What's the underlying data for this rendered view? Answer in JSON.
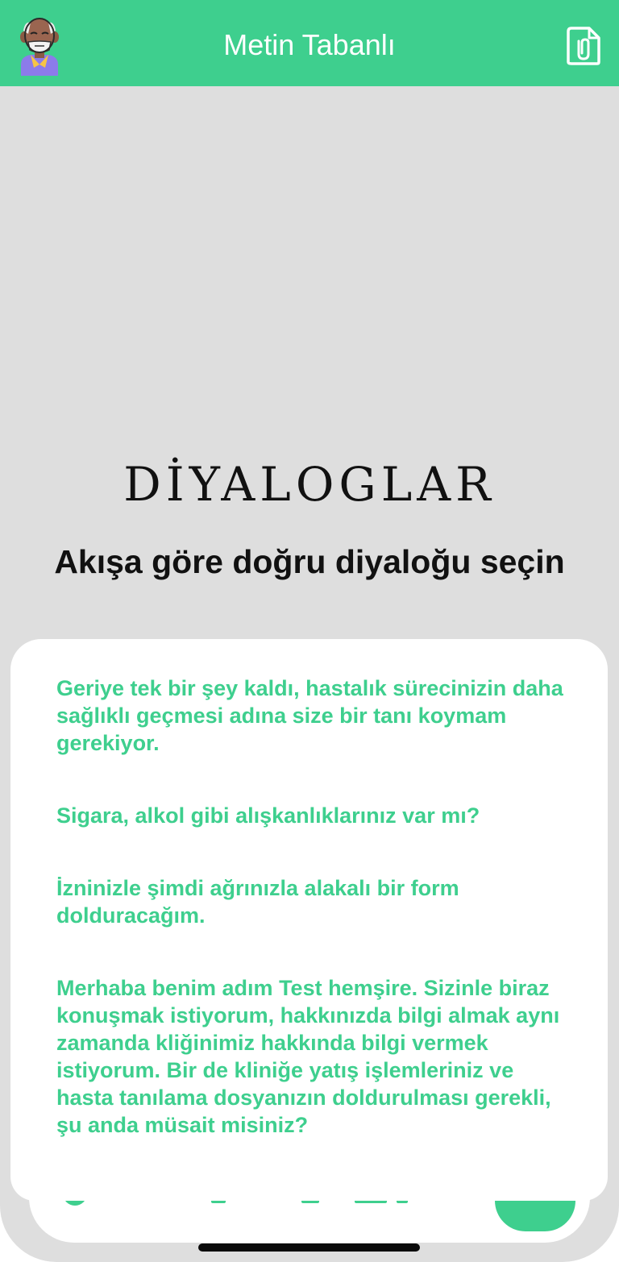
{
  "header": {
    "title": "Metin Tabanlı",
    "background_color": "#3ecf8e",
    "avatar_icon": "elderly-patient-avatar-icon",
    "attach_icon": "paperclip-document-icon"
  },
  "main": {
    "heading": "DİYALOGLAR",
    "subheading": "Akışa göre doğru diyaloğu seçin"
  },
  "dialog_options": [
    {
      "text": "Geriye tek bir şey kaldı, hastalık sürecinizin daha sağlıklı geçmesi adına size bir tanı koymam gerekiyor."
    },
    {
      "text": "Sigara, alkol gibi alışkanlıklarınız var mı?"
    },
    {
      "text": "İzninizle şimdi ağrınızla alakalı bir form dolduracağım."
    },
    {
      "text": "Merhaba benim adım Test hemşire. Sizinle biraz konuşmak istiyorum, hakkınızda bilgi almak aynı zamanda kliğinimiz hakkında bilgi vermek istiyorum. Bir de kliniğe yatış işlemleriniz ve hasta tanılama dosyanızın doldurulması gerekli, şu anda müsait misiniz?"
    }
  ],
  "colors": {
    "accent": "#3ecf8e",
    "background": "#dedede",
    "sheet": "#ffffff",
    "text_dark": "#111111"
  }
}
